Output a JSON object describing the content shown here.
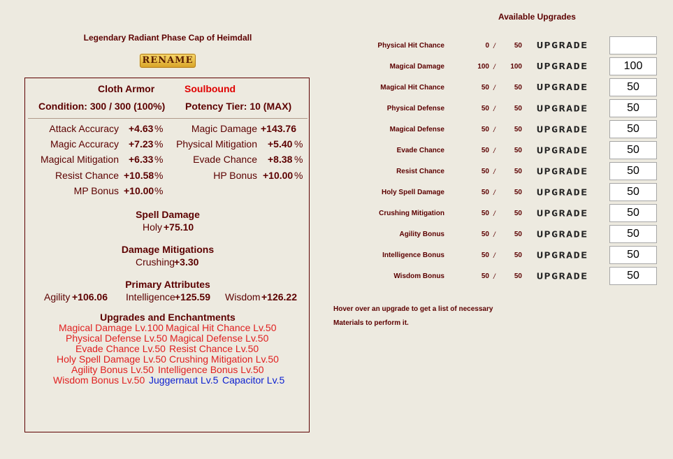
{
  "item": {
    "title": "Legendary Radiant Phase Cap of Heimdall",
    "rename_label": "RENAME",
    "armor_type": "Cloth Armor",
    "bound": "Soulbound",
    "condition": "Condition: 300 / 300 (100%)",
    "potency": "Potency Tier: 10 (MAX)"
  },
  "stats": [
    {
      "label": "Attack Accuracy",
      "value": "+4.63",
      "unit": "%"
    },
    {
      "label": "Magic Damage",
      "value": "+143.76",
      "unit": ""
    },
    {
      "label": "Magic Accuracy",
      "value": "+7.23",
      "unit": "%"
    },
    {
      "label": "Physical Mitigation",
      "value": "+5.40",
      "unit": "%"
    },
    {
      "label": "Magical Mitigation",
      "value": "+6.33",
      "unit": "%"
    },
    {
      "label": "Evade Chance",
      "value": "+8.38",
      "unit": "%"
    },
    {
      "label": "Resist Chance",
      "value": "+10.58",
      "unit": "%"
    },
    {
      "label": "HP Bonus",
      "value": "+10.00",
      "unit": "%"
    },
    {
      "label": "MP Bonus",
      "value": "+10.00",
      "unit": "%"
    }
  ],
  "spell_damage": {
    "heading": "Spell Damage",
    "label": "Holy",
    "value": "+75.10"
  },
  "damage_mitigations": {
    "heading": "Damage Mitigations",
    "label": "Crushing",
    "value": "+3.30"
  },
  "primary_attributes": {
    "heading": "Primary Attributes",
    "items": [
      {
        "label": "Agility",
        "value": "+106.06"
      },
      {
        "label": "Intelligence",
        "value": "+125.59"
      },
      {
        "label": "Wisdom",
        "value": "+126.22"
      }
    ]
  },
  "upgrades_enchantments": {
    "heading": "Upgrades and Enchantments",
    "upgrades": [
      "Magical Damage Lv.100",
      "Magical Hit Chance Lv.50",
      "Physical Defense Lv.50",
      "Magical Defense Lv.50",
      "Evade Chance Lv.50",
      "Resist Chance Lv.50",
      "Holy Spell Damage Lv.50",
      "Crushing Mitigation Lv.50",
      "Agility Bonus Lv.50",
      "Intelligence Bonus Lv.50",
      "Wisdom Bonus Lv.50"
    ],
    "enchantments": [
      "Juggernaut Lv.5",
      "Capacitor Lv.5"
    ]
  },
  "available_upgrades": {
    "title": "Available Upgrades",
    "separator": "/",
    "button_label": "UPGRADE",
    "rows": [
      {
        "name": "Physical Hit Chance",
        "current": "0",
        "max": "50",
        "input": ""
      },
      {
        "name": "Magical Damage",
        "current": "100",
        "max": "100",
        "input": "100"
      },
      {
        "name": "Magical Hit Chance",
        "current": "50",
        "max": "50",
        "input": "50"
      },
      {
        "name": "Physical Defense",
        "current": "50",
        "max": "50",
        "input": "50"
      },
      {
        "name": "Magical Defense",
        "current": "50",
        "max": "50",
        "input": "50"
      },
      {
        "name": "Evade Chance",
        "current": "50",
        "max": "50",
        "input": "50"
      },
      {
        "name": "Resist Chance",
        "current": "50",
        "max": "50",
        "input": "50"
      },
      {
        "name": "Holy Spell Damage",
        "current": "50",
        "max": "50",
        "input": "50"
      },
      {
        "name": "Crushing Mitigation",
        "current": "50",
        "max": "50",
        "input": "50"
      },
      {
        "name": "Agility Bonus",
        "current": "50",
        "max": "50",
        "input": "50"
      },
      {
        "name": "Intelligence Bonus",
        "current": "50",
        "max": "50",
        "input": "50"
      },
      {
        "name": "Wisdom Bonus",
        "current": "50",
        "max": "50",
        "input": "50"
      }
    ],
    "hover_note_1": "Hover over an upgrade to get a list of necessary",
    "hover_note_2": "Materials to perform it."
  },
  "colors": {
    "text": "#5C0000",
    "soulbound": "#E00000",
    "upgrade": "#E02020",
    "enchantment": "#0A1ED0",
    "background": "#EDEAE0"
  }
}
